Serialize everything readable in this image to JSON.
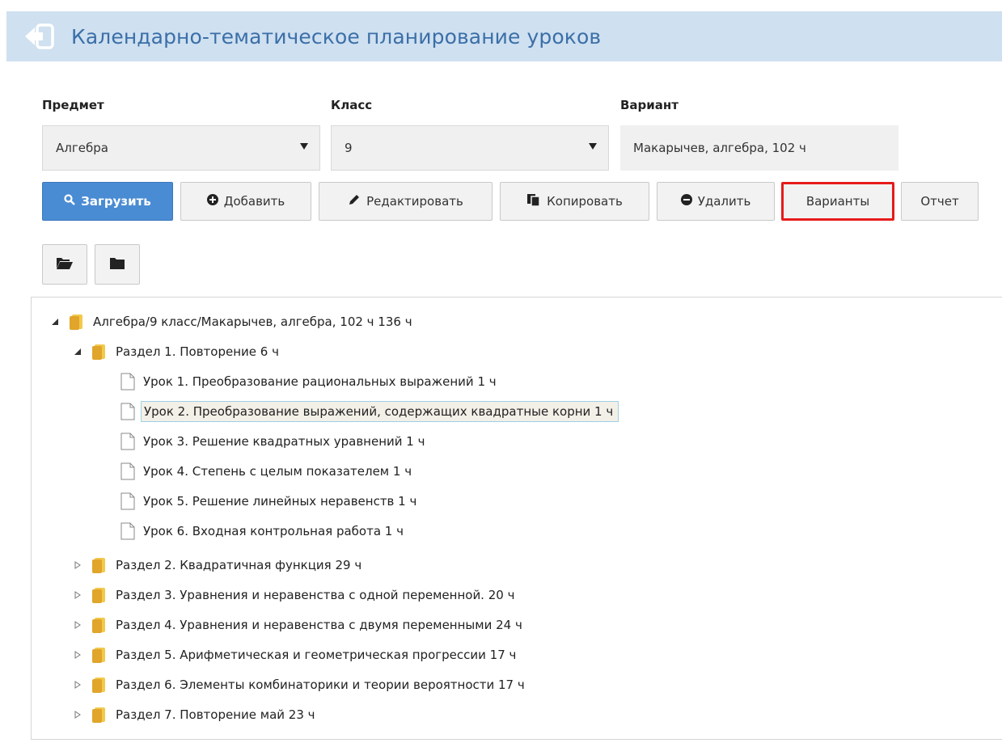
{
  "header": {
    "title": "Календарно-тематическое планирование уроков",
    "back_icon": "exit-arrow-icon"
  },
  "filters": {
    "subject_label": "Предмет",
    "subject_value": "Алгебра",
    "class_label": "Класс",
    "class_value": "9",
    "variant_label": "Вариант",
    "variant_value": "Макарычев, алгебра, 102 ч"
  },
  "toolbar": {
    "load": "Загрузить",
    "add": "Добавить",
    "edit": "Редактировать",
    "copy": "Копировать",
    "delete": "Удалить",
    "variants": "Варианты",
    "report": "Отчет"
  },
  "tree_tools": {
    "open_icon": "folder-open-icon",
    "closed_icon": "folder-closed-icon"
  },
  "colors": {
    "header_bg": "#cfe0f0",
    "title": "#3b6fa8",
    "primary": "#4a8cd3",
    "highlight": "#e61b1b",
    "folder": "#e8b830"
  },
  "tree": {
    "root": "Алгебра/9 класс/Макарычев, алгебра, 102 ч 136 ч",
    "section1": "Раздел 1. Повторение 6 ч",
    "lessons": [
      "Урок 1. Преобразование рациональных выражений 1 ч",
      "Урок 2. Преобразование выражений, содержащих квадратные корни 1 ч",
      "Урок 3. Решение квадратных уравнений 1 ч",
      "Урок 4. Степень с целым показателем 1 ч",
      "Урок 5. Решение линейных неравенств 1 ч",
      "Урок 6. Входная контрольная работа 1 ч"
    ],
    "sections": [
      "Раздел 2. Квадратичная функция 29 ч",
      "Раздел 3. Уравнения и неравенства с одной переменной. 20 ч",
      "Раздел 4. Уравнения и неравенства с двумя переменными 24 ч",
      "Раздел 5. Арифметическая и геометрическая прогрессии 17 ч",
      "Раздел 6. Элементы комбинаторики и теории вероятности 17 ч",
      "Раздел 7. Повторение май 23 ч"
    ]
  }
}
